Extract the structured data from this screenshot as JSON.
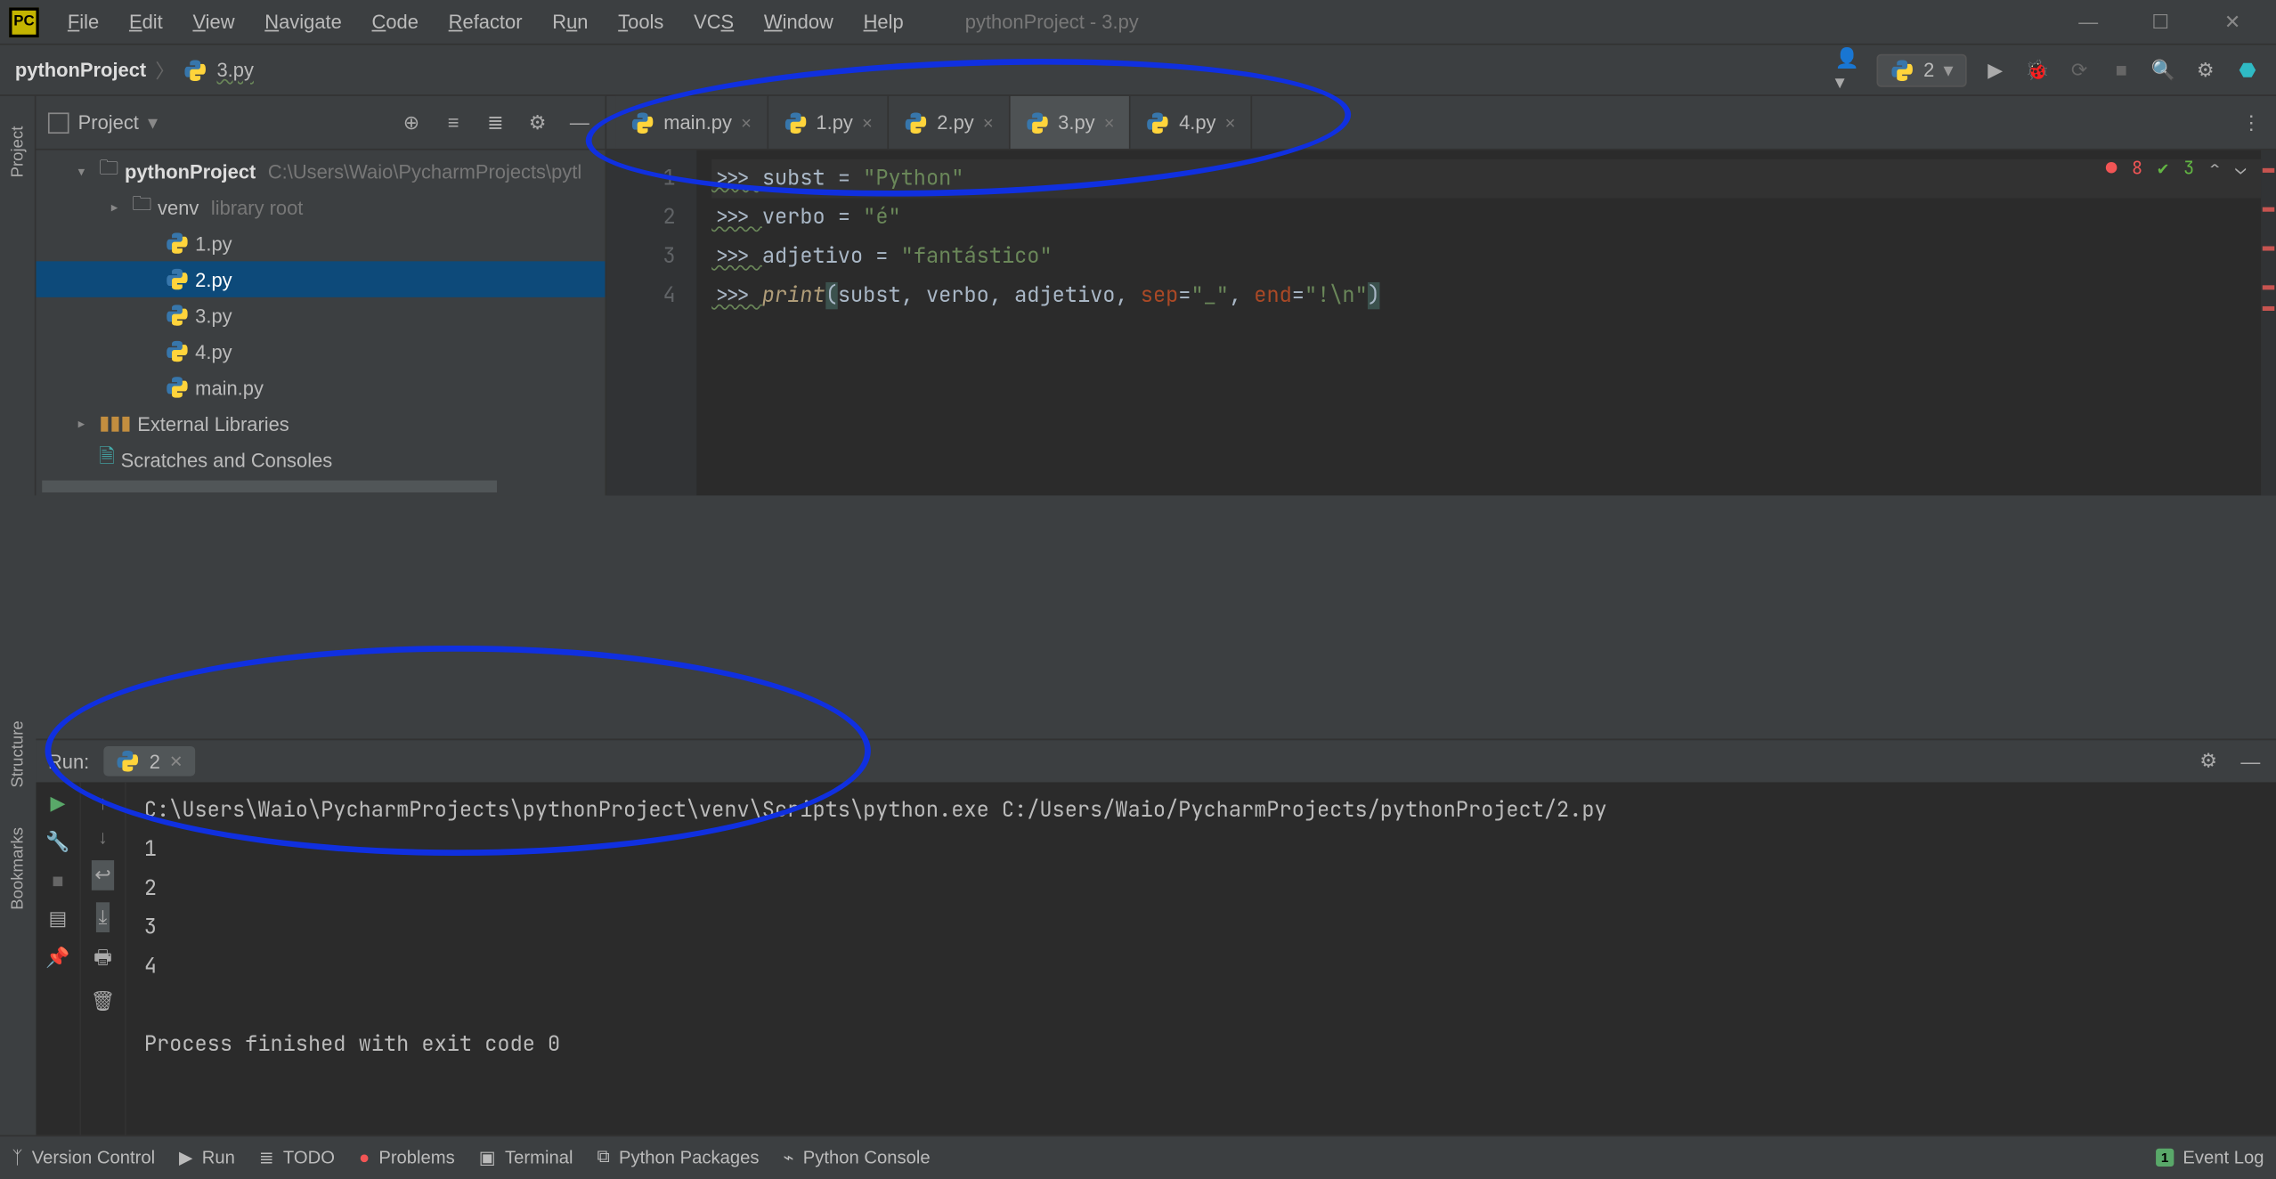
{
  "window": {
    "title": "pythonProject - 3.py"
  },
  "menu": [
    "File",
    "Edit",
    "View",
    "Navigate",
    "Code",
    "Refactor",
    "Run",
    "Tools",
    "VCS",
    "Window",
    "Help"
  ],
  "breadcrumb": {
    "root": "pythonProject",
    "file": "3.py"
  },
  "run_config": {
    "name": "2"
  },
  "project_panel": {
    "title": "Project",
    "tree": {
      "root": {
        "name": "pythonProject",
        "path": "C:\\Users\\Waio\\PycharmProjects\\pytl"
      },
      "venv": {
        "name": "venv",
        "hint": "library root"
      },
      "files": [
        "1.py",
        "2.py",
        "3.py",
        "4.py",
        "main.py"
      ],
      "selected": "2.py",
      "ext_libs": "External Libraries",
      "scratches": "Scratches and Consoles"
    }
  },
  "tabs": [
    {
      "name": "main.py",
      "active": false
    },
    {
      "name": "1.py",
      "active": false
    },
    {
      "name": "2.py",
      "active": false
    },
    {
      "name": "3.py",
      "active": true
    },
    {
      "name": "4.py",
      "active": false
    }
  ],
  "editor": {
    "lines": [
      {
        "n": 1,
        "prompt": ">>> ",
        "code": [
          [
            "id",
            "subst"
          ],
          [
            "ws",
            " "
          ],
          [
            "op",
            "="
          ],
          [
            "ws",
            " "
          ],
          [
            "str",
            "\"Python\""
          ]
        ]
      },
      {
        "n": 2,
        "prompt": ">>> ",
        "code": [
          [
            "id",
            "verbo"
          ],
          [
            "ws",
            " "
          ],
          [
            "op",
            "="
          ],
          [
            "ws",
            " "
          ],
          [
            "str",
            "\"é\""
          ]
        ]
      },
      {
        "n": 3,
        "prompt": ">>> ",
        "code": [
          [
            "id",
            "adjetivo"
          ],
          [
            "ws",
            " "
          ],
          [
            "op",
            "="
          ],
          [
            "ws",
            " "
          ],
          [
            "str",
            "\"fantástico\""
          ]
        ]
      },
      {
        "n": 4,
        "prompt": ">>> ",
        "code": [
          [
            "fn",
            "print"
          ],
          [
            "parO",
            "("
          ],
          [
            "id",
            "subst"
          ],
          [
            "op",
            ", "
          ],
          [
            "id",
            "verbo"
          ],
          [
            "op",
            ", "
          ],
          [
            "id",
            "adjetivo"
          ],
          [
            "op",
            ", "
          ],
          [
            "par",
            "sep"
          ],
          [
            "op",
            "="
          ],
          [
            "str",
            "\"_\""
          ],
          [
            "op",
            ", "
          ],
          [
            "par",
            "end"
          ],
          [
            "op",
            "="
          ],
          [
            "str",
            "\"!\\n\""
          ],
          [
            "parC",
            ")"
          ]
        ]
      }
    ],
    "status": {
      "errors": "8",
      "warnings": "3"
    }
  },
  "run_panel": {
    "label": "Run:",
    "tab": "2",
    "console": "C:\\Users\\Waio\\PycharmProjects\\pythonProject\\venv\\Scripts\\python.exe C:/Users/Waio/PycharmProjects/pythonProject/2.py\n1\n2\n3\n4\n\nProcess finished with exit code 0"
  },
  "left_rail": [
    "Project",
    "Structure",
    "Bookmarks"
  ],
  "statusbar": {
    "items": [
      "Version Control",
      "Run",
      "TODO",
      "Problems",
      "Terminal",
      "Python Packages",
      "Python Console"
    ],
    "event_log": "Event Log"
  }
}
